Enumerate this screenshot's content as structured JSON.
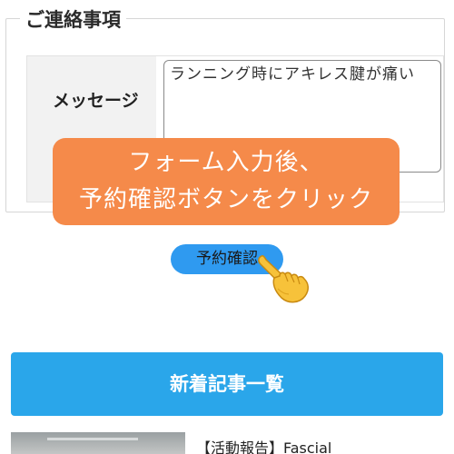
{
  "contact": {
    "section_title": "ご連絡事項",
    "message_label": "メッセージ",
    "message_value": "ランニング時にアキレス腱が痛い"
  },
  "callout": {
    "line1": "フォーム入力後、",
    "line2": "予約確認ボタンをクリック"
  },
  "reserve_button_label": "予約確認",
  "articles_button_label": "新着記事一覧",
  "articles": [
    {
      "title": "【活動報告】Fascial"
    }
  ],
  "colors": {
    "callout_bg": "#f58a4a",
    "reserve_button": "#2f9af0",
    "articles_button": "#2aa6ea"
  },
  "icons": {
    "pointer": "pointing-hand-icon"
  }
}
